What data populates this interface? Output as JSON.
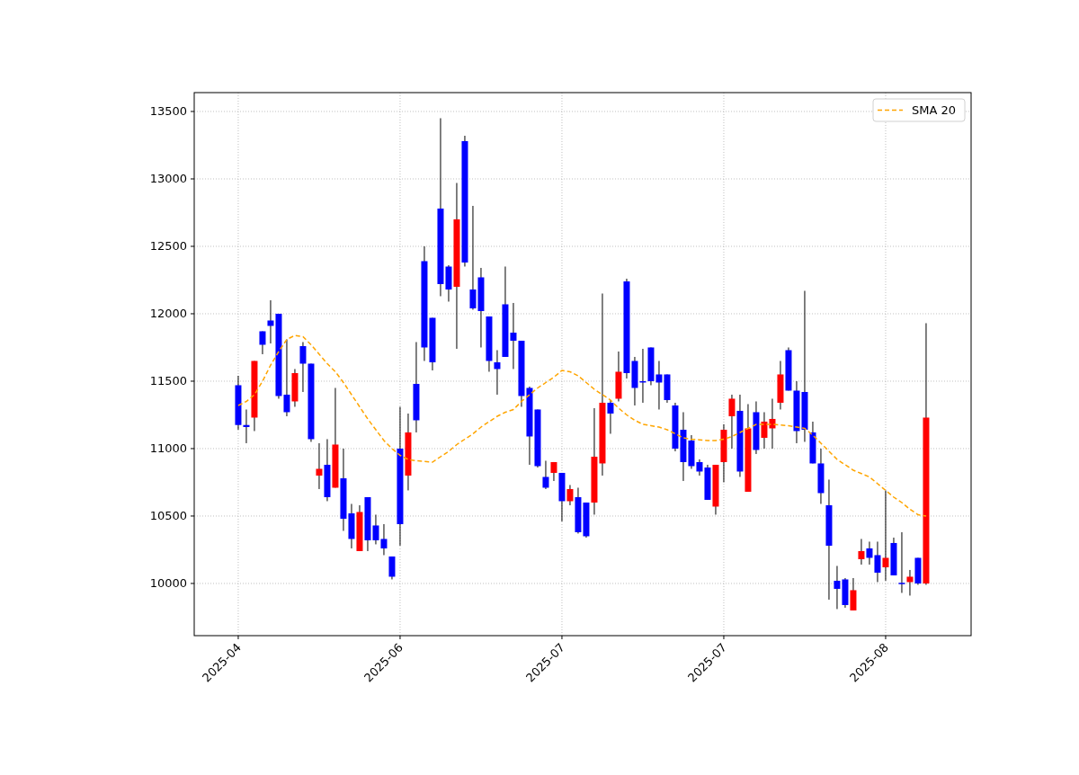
{
  "chart_data": {
    "type": "candlestick",
    "categories": [
      "2025-04",
      null,
      null,
      null,
      null,
      null,
      null,
      null,
      null,
      null,
      null,
      null,
      null,
      null,
      null,
      null,
      null,
      null,
      null,
      null,
      "2025-06",
      null,
      null,
      null,
      null,
      null,
      null,
      null,
      null,
      null,
      null,
      null,
      null,
      null,
      null,
      null,
      null,
      null,
      null,
      null,
      "2025-07",
      null,
      null,
      null,
      null,
      null,
      null,
      null,
      null,
      null,
      null,
      null,
      null,
      null,
      null,
      null,
      null,
      null,
      null,
      null,
      "2025-07",
      null,
      null,
      null,
      null,
      null,
      null,
      null,
      null,
      null,
      null,
      null,
      null,
      null,
      null,
      null,
      null,
      null,
      null,
      null,
      "2025-08",
      null,
      null,
      null,
      null,
      null
    ],
    "grid": true,
    "ylim": [
      9613,
      13640
    ],
    "yticks": [
      10000,
      10500,
      11000,
      11500,
      12000,
      12500,
      13000,
      13500
    ],
    "ohlc": [
      [
        11175,
        11540,
        11140,
        11470
      ],
      [
        11160,
        11290,
        11040,
        11175
      ],
      [
        11650,
        11650,
        11130,
        11230
      ],
      [
        11770,
        11870,
        11700,
        11870
      ],
      [
        11910,
        12100,
        11780,
        11950
      ],
      [
        11390,
        12000,
        11370,
        12000
      ],
      [
        11270,
        11810,
        11240,
        11400
      ],
      [
        11560,
        11590,
        11310,
        11350
      ],
      [
        11630,
        11790,
        11420,
        11760
      ],
      [
        11070,
        11630,
        11050,
        11630
      ],
      [
        10850,
        11040,
        10700,
        10800
      ],
      [
        10640,
        11070,
        10610,
        10880
      ],
      [
        11030,
        11450,
        10710,
        10710
      ],
      [
        10480,
        11000,
        10390,
        10780
      ],
      [
        10330,
        10590,
        10260,
        10520
      ],
      [
        10530,
        10580,
        10240,
        10240
      ],
      [
        10320,
        10640,
        10240,
        10640
      ],
      [
        10320,
        10510,
        10290,
        10430
      ],
      [
        10260,
        10440,
        10210,
        10330
      ],
      [
        10050,
        10200,
        10030,
        10200
      ],
      [
        10440,
        11310,
        10280,
        11000
      ],
      [
        11120,
        11260,
        10690,
        10800
      ],
      [
        11210,
        11790,
        11120,
        11480
      ],
      [
        11750,
        12500,
        11650,
        12390
      ],
      [
        11640,
        11970,
        11580,
        11970
      ],
      [
        12220,
        13450,
        12130,
        12780
      ],
      [
        12180,
        12360,
        12090,
        12350
      ],
      [
        12700,
        12970,
        11740,
        12200
      ],
      [
        12380,
        13320,
        12350,
        13280
      ],
      [
        12040,
        12800,
        12030,
        12180
      ],
      [
        12020,
        12340,
        11750,
        12270
      ],
      [
        11650,
        11980,
        11570,
        11980
      ],
      [
        11590,
        11730,
        11400,
        11640
      ],
      [
        11680,
        12350,
        11680,
        12070
      ],
      [
        11800,
        12080,
        11590,
        11860
      ],
      [
        11390,
        11800,
        11310,
        11800
      ],
      [
        11090,
        11460,
        10880,
        11450
      ],
      [
        10870,
        11290,
        10860,
        11290
      ],
      [
        10710,
        10910,
        10700,
        10790
      ],
      [
        10900,
        10900,
        10760,
        10820
      ],
      [
        10610,
        10820,
        10460,
        10820
      ],
      [
        10700,
        10730,
        10580,
        10610
      ],
      [
        10380,
        10710,
        10370,
        10640
      ],
      [
        10350,
        10600,
        10340,
        10600
      ],
      [
        10940,
        11300,
        10510,
        10600
      ],
      [
        11340,
        12150,
        10800,
        10890
      ],
      [
        11260,
        11360,
        11110,
        11340
      ],
      [
        11570,
        11720,
        11350,
        11370
      ],
      [
        11560,
        12260,
        11520,
        12240
      ],
      [
        11450,
        11680,
        11320,
        11650
      ],
      [
        11490,
        11740,
        11340,
        11500
      ],
      [
        11500,
        11750,
        11470,
        11750
      ],
      [
        11490,
        11650,
        11290,
        11550
      ],
      [
        11360,
        11550,
        11340,
        11550
      ],
      [
        11000,
        11340,
        10980,
        11320
      ],
      [
        10900,
        11270,
        10760,
        11140
      ],
      [
        10870,
        11100,
        10850,
        11060
      ],
      [
        10830,
        10920,
        10800,
        10900
      ],
      [
        10620,
        10880,
        10620,
        10860
      ],
      [
        10880,
        10880,
        10510,
        10570
      ],
      [
        11140,
        11180,
        10750,
        10900
      ],
      [
        11370,
        11400,
        11000,
        11240
      ],
      [
        10830,
        11400,
        10790,
        11280
      ],
      [
        11150,
        11330,
        10680,
        10680
      ],
      [
        10990,
        11350,
        10960,
        11270
      ],
      [
        11200,
        11270,
        11000,
        11080
      ],
      [
        11220,
        11370,
        11000,
        11150
      ],
      [
        11550,
        11650,
        11290,
        11340
      ],
      [
        11430,
        11750,
        11430,
        11730
      ],
      [
        11130,
        11500,
        11040,
        11430
      ],
      [
        11140,
        12170,
        11050,
        11420
      ],
      [
        10890,
        11200,
        10890,
        11120
      ],
      [
        10670,
        11000,
        10590,
        10890
      ],
      [
        10280,
        10770,
        9880,
        10580
      ],
      [
        9960,
        10130,
        9810,
        10020
      ],
      [
        9840,
        10040,
        9820,
        10030
      ],
      [
        9950,
        10040,
        9800,
        9800
      ],
      [
        10240,
        10330,
        10140,
        10180
      ],
      [
        10190,
        10310,
        10140,
        10260
      ],
      [
        10080,
        10310,
        10010,
        10210
      ],
      [
        10190,
        10690,
        10020,
        10120
      ],
      [
        10060,
        10340,
        10060,
        10300
      ],
      [
        9995,
        10380,
        9930,
        10005
      ],
      [
        10050,
        10100,
        9910,
        10010
      ],
      [
        10000,
        10190,
        9990,
        10190
      ],
      [
        11230,
        11930,
        9990,
        10000
      ]
    ],
    "series": [
      {
        "name": "SMA 20",
        "type": "line",
        "line_style": "dashed",
        "color": "#ffa500",
        "values": [
          11320,
          11350,
          11400,
          11500,
          11620,
          11720,
          11810,
          11840,
          11830,
          11770,
          11700,
          11630,
          11570,
          11490,
          11400,
          11310,
          11220,
          11140,
          11060,
          11000,
          10950,
          10920,
          10910,
          10905,
          10900,
          10940,
          10980,
          11030,
          11070,
          11110,
          11160,
          11200,
          11240,
          11270,
          11290,
          11350,
          11400,
          11450,
          11490,
          11530,
          11580,
          11570,
          11540,
          11490,
          11440,
          11400,
          11360,
          11300,
          11250,
          11210,
          11180,
          11170,
          11160,
          11140,
          11110,
          11080,
          11070,
          11065,
          11060,
          11060,
          11070,
          11090,
          11120,
          11150,
          11180,
          11180,
          11180,
          11175,
          11170,
          11160,
          11150,
          11100,
          11040,
          10980,
          10920,
          10880,
          10840,
          10815,
          10790,
          10740,
          10690,
          10640,
          10600,
          10550,
          10510,
          10500
        ]
      }
    ]
  }
}
